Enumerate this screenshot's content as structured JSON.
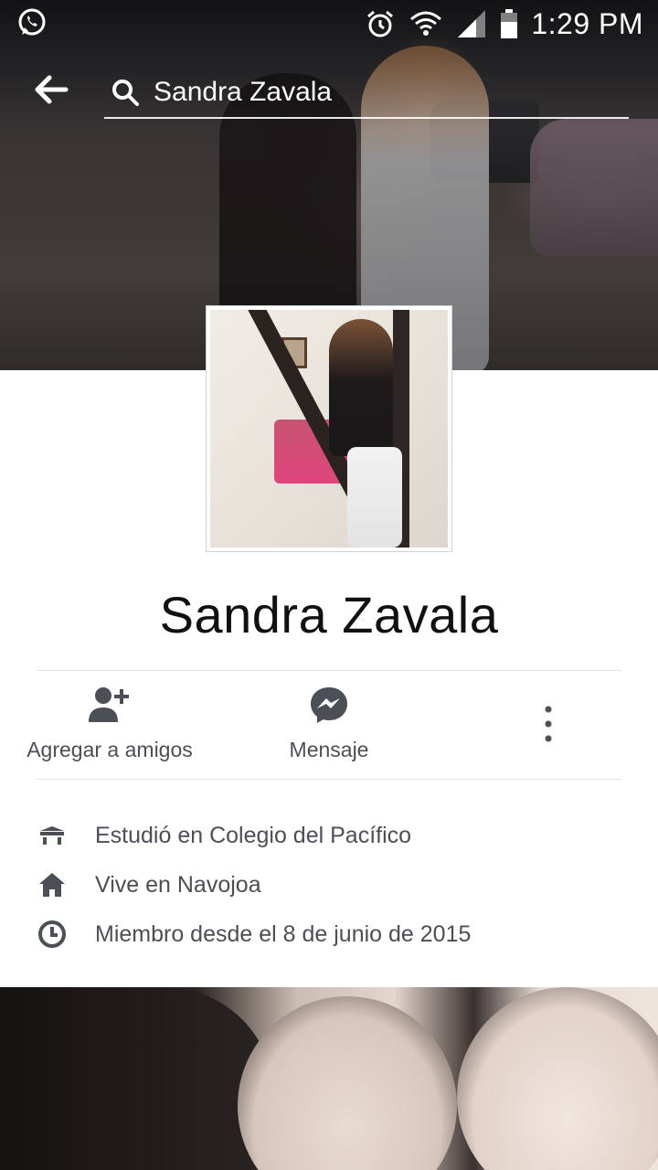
{
  "status_bar": {
    "time": "1:29 PM",
    "left_icons": [
      "whatsapp-icon"
    ],
    "right_icons": [
      "alarm-icon",
      "wifi-icon",
      "signal-icon",
      "battery-icon"
    ]
  },
  "search": {
    "query": "Sandra Zavala"
  },
  "profile": {
    "name": "Sandra Zavala"
  },
  "actions": [
    {
      "label": "Agregar a amigos",
      "icon": "add-friend-icon"
    },
    {
      "label": "Mensaje",
      "icon": "messenger-icon"
    },
    {
      "label": "",
      "icon": "more-options-icon"
    }
  ],
  "info": [
    {
      "icon": "school-icon",
      "text": "Estudió en Colegio del Pacífico"
    },
    {
      "icon": "home-icon",
      "text": "Vive en Navojoa"
    },
    {
      "icon": "clock-icon",
      "text": "Miembro desde el 8 de junio de 2015"
    }
  ],
  "colors": {
    "icon_gray": "#4b4f56",
    "divider": "#e2e4e8"
  }
}
